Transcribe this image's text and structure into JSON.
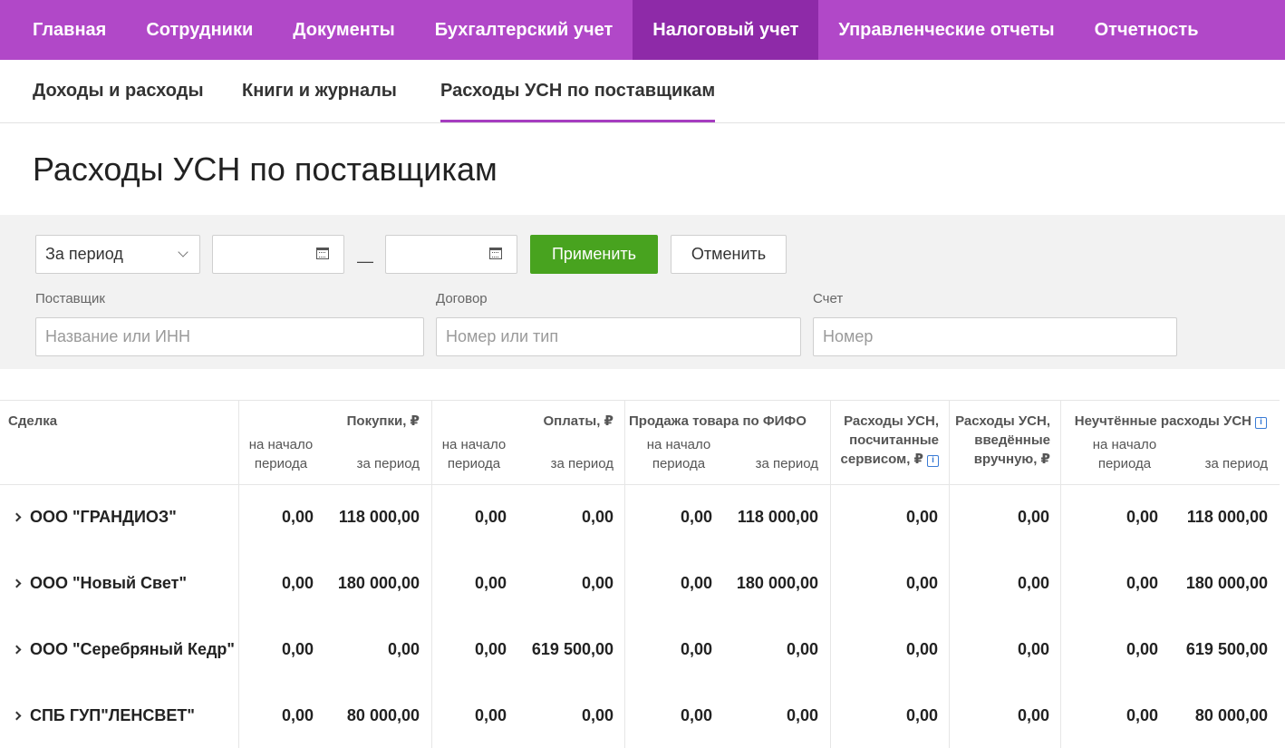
{
  "top_nav": [
    "Главная",
    "Сотрудники",
    "Документы",
    "Бухгалтерский учет",
    "Налоговый учет",
    "Управленческие отчеты",
    "Отчетность"
  ],
  "top_nav_active": "Налоговый учет",
  "sub_nav": [
    "Доходы и расходы",
    "Книги и журналы",
    "Расходы УСН по поставщикам"
  ],
  "sub_nav_active": "Расходы УСН по поставщикам",
  "page_title": "Расходы УСН по поставщикам",
  "filters": {
    "period_select": "За период",
    "date_from": "",
    "date_to": "",
    "dash": "—",
    "apply_label": "Применить",
    "cancel_label": "Отменить",
    "supplier_label": "Поставщик",
    "supplier_placeholder": "Название или ИНН",
    "contract_label": "Договор",
    "contract_placeholder": "Номер или тип",
    "account_label": "Счет",
    "account_placeholder": "Номер"
  },
  "table": {
    "headers": {
      "deal": "Сделка",
      "purchases": "Покупки, ₽",
      "payments": "Оплаты, ₽",
      "fifo": "Продажа товара по ФИФО",
      "service_line1": "Расходы УСН,",
      "service_line2": "посчитанные",
      "service_line3": "сервисом, ₽",
      "manual_line1": "Расходы УСН,",
      "manual_line2": "введённые",
      "manual_line3": "вручную, ₽",
      "unaccounted": "Неучтённые расходы УСН",
      "start_line1": "на начало",
      "start_line2": "периода",
      "period": "за период",
      "info_glyph": "i"
    },
    "rows": [
      {
        "name": "ООО \"ГРАНДИОЗ\"",
        "values": [
          "0,00",
          "118 000,00",
          "0,00",
          "0,00",
          "0,00",
          "118 000,00",
          "0,00",
          "0,00",
          "0,00",
          "118 000,00"
        ]
      },
      {
        "name": "ООО \"Новый Свет\"",
        "values": [
          "0,00",
          "180 000,00",
          "0,00",
          "0,00",
          "0,00",
          "180 000,00",
          "0,00",
          "0,00",
          "0,00",
          "180 000,00"
        ]
      },
      {
        "name": "ООО \"Серебряный Кедр\"",
        "values": [
          "0,00",
          "0,00",
          "0,00",
          "619 500,00",
          "0,00",
          "0,00",
          "0,00",
          "0,00",
          "0,00",
          "619 500,00"
        ]
      },
      {
        "name": "СПБ ГУП\"ЛЕНСВЕТ\"",
        "values": [
          "0,00",
          "80 000,00",
          "0,00",
          "0,00",
          "0,00",
          "0,00",
          "0,00",
          "0,00",
          "0,00",
          "80 000,00"
        ]
      }
    ]
  },
  "colors": {
    "nav_bg": "#b148c8",
    "nav_active_bg": "#8e2aa8",
    "sub_underline": "#a63dc0",
    "apply_button": "#48a31f",
    "info_icon": "#3a7bd5"
  }
}
